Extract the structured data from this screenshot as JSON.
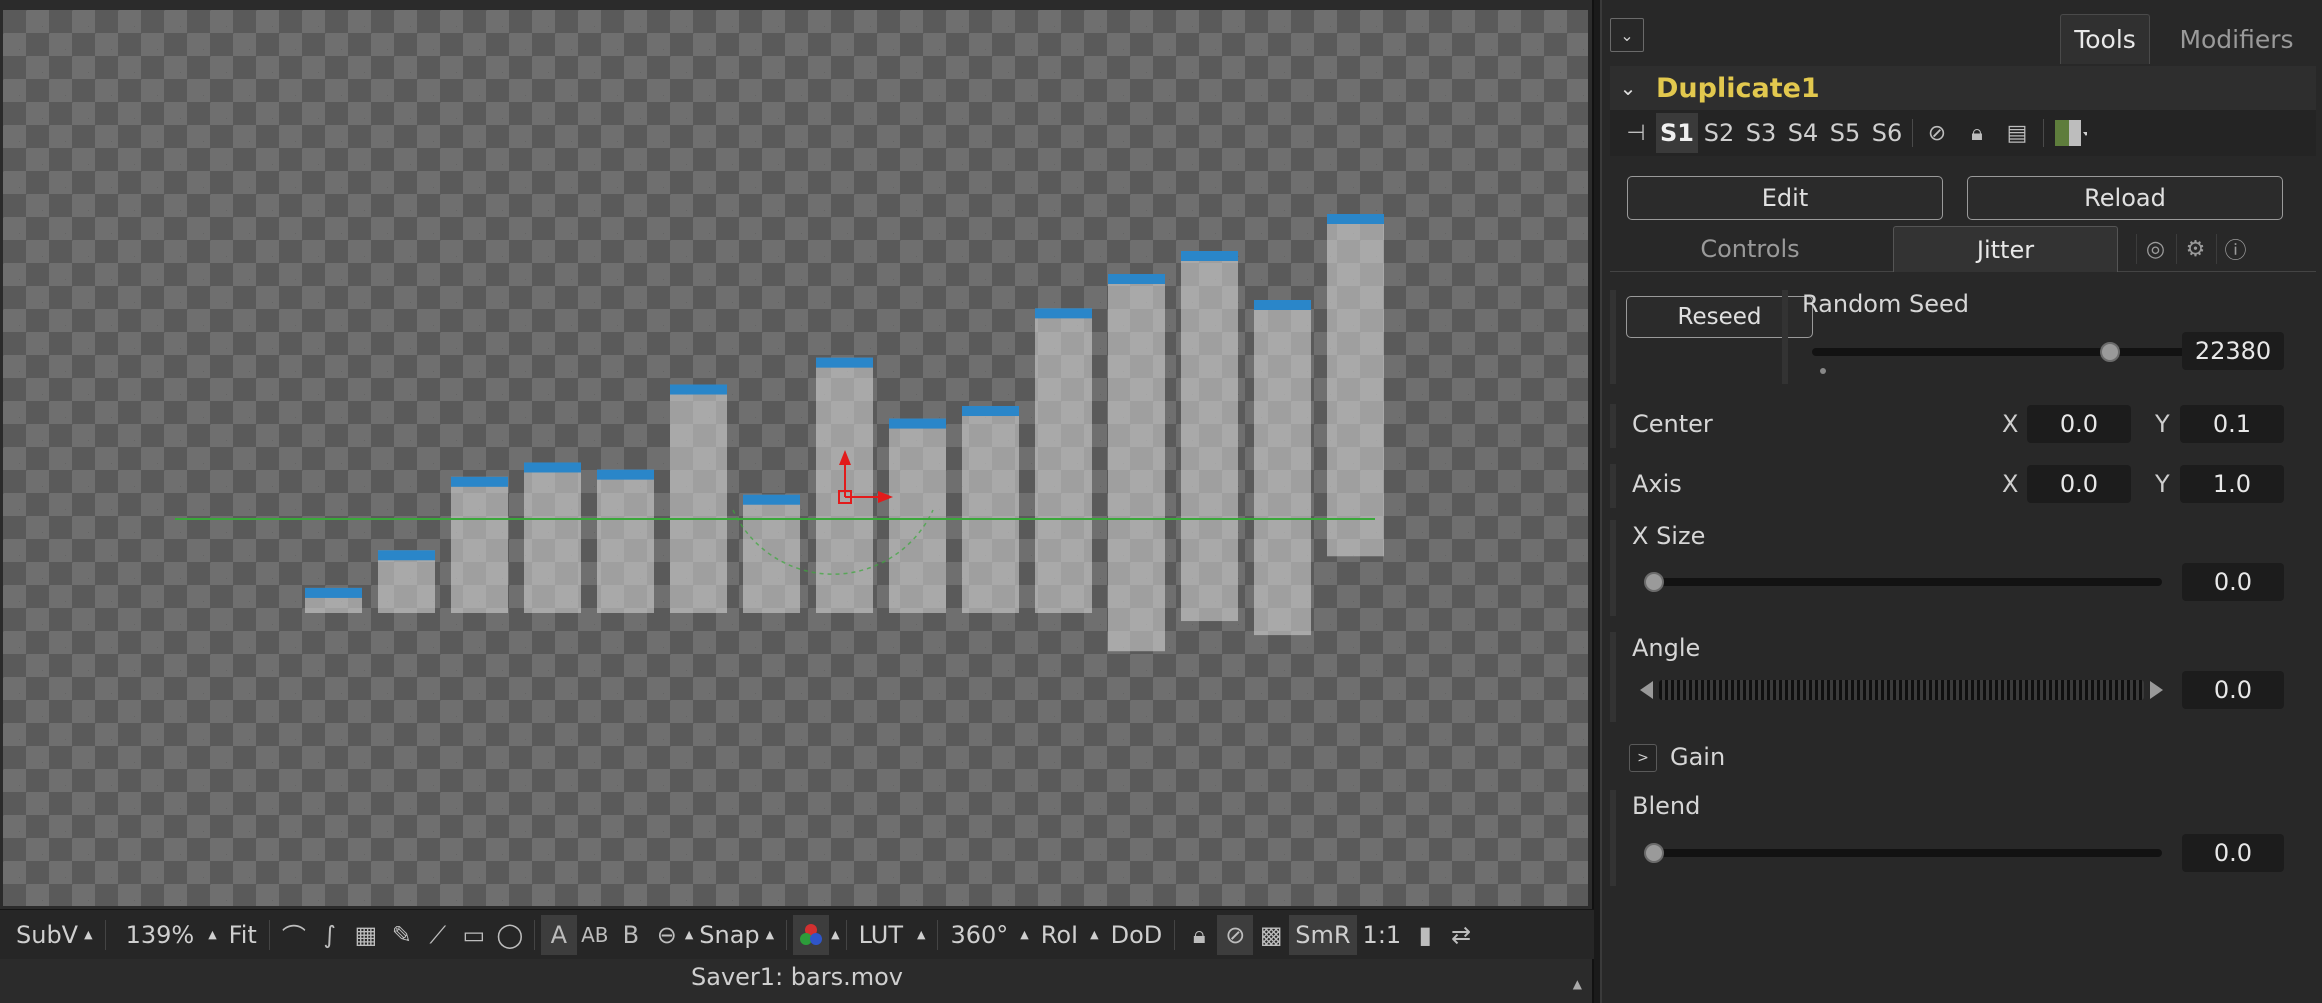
{
  "viewer": {
    "toolbar": {
      "subv": "SubV",
      "zoom": "139%",
      "fit": "Fit",
      "text_a": "A",
      "text_ab": "AB",
      "text_b": "B",
      "snap": "Snap",
      "lut": "LUT",
      "angle": "360°",
      "roi": "RoI",
      "dod": "DoD",
      "smr": "SmR",
      "ratio": "1:1"
    },
    "status": "Saver1: bars.mov",
    "bars": [
      {
        "height": 0.028
      },
      {
        "height": 0.07
      },
      {
        "height": 0.152
      },
      {
        "height": 0.168
      },
      {
        "height": 0.16
      },
      {
        "height": 0.255
      },
      {
        "height": 0.132
      },
      {
        "height": 0.285
      },
      {
        "height": 0.217
      },
      {
        "height": 0.231
      },
      {
        "height": 0.34
      },
      {
        "height": 0.421
      },
      {
        "height": 0.413
      },
      {
        "height": 0.374
      },
      {
        "height": 0.382
      }
    ],
    "colors": {
      "bar": "#d8d8d8",
      "bar_top": "#2a86c9",
      "guide": "#3aa83a",
      "axis_red": "#e21b1b"
    }
  },
  "inspector": {
    "tabs": {
      "tools": "Tools",
      "modifiers": "Modifiers"
    },
    "tool_name": "Duplicate1",
    "slots": [
      "S1",
      "S2",
      "S3",
      "S4",
      "S5",
      "S6"
    ],
    "active_slot": "S1",
    "edit_label": "Edit",
    "reload_label": "Reload",
    "subtabs": {
      "controls": "Controls",
      "jitter": "Jitter"
    },
    "reseed_label": "Reseed",
    "random_seed": {
      "label": "Random Seed",
      "value": "22380",
      "fraction": 0.67
    },
    "center": {
      "label": "Center",
      "x_label": "X",
      "x": "0.0",
      "y_label": "Y",
      "y": "0.1"
    },
    "axis": {
      "label": "Axis",
      "x_label": "X",
      "x": "0.0",
      "y_label": "Y",
      "y": "1.0"
    },
    "x_size": {
      "label": "X Size",
      "value": "0.0",
      "fraction": 0.0
    },
    "angle": {
      "label": "Angle",
      "value": "0.0"
    },
    "gain": {
      "label": "Gain",
      "toggle": ">"
    },
    "blend": {
      "label": "Blend",
      "value": "0.0",
      "fraction": 0.0
    },
    "accent": "#e2c84e"
  }
}
